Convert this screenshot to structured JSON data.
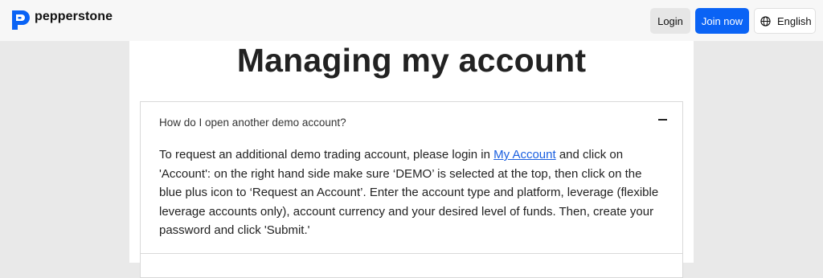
{
  "header": {
    "brand_name": "pepperstone",
    "login_label": "Login",
    "join_label": "Join now",
    "language_label": "English"
  },
  "main": {
    "title": "Managing my account",
    "faq": {
      "question": "How do I open another demo account?",
      "answer_before_link": "To request an additional demo trading account, please login in ",
      "answer_link": "My Account",
      "answer_after_link": " and click on 'Account': on the right hand side make sure ‘DEMO’ is selected at the top, then click on the blue plus icon to ‘Request an Account’. Enter the account type and platform, leverage (flexible leverage accounts only), account currency and your desired level of funds. Then, create your password and click 'Submit.'"
    }
  },
  "colors": {
    "brand_blue": "#0a63f5",
    "link_blue": "#1a5fe0",
    "page_background": "#e9e9e9"
  },
  "icons": {
    "logo": "pepperstone-logo-icon",
    "language": "globe-icon",
    "collapse": "minus-icon"
  }
}
